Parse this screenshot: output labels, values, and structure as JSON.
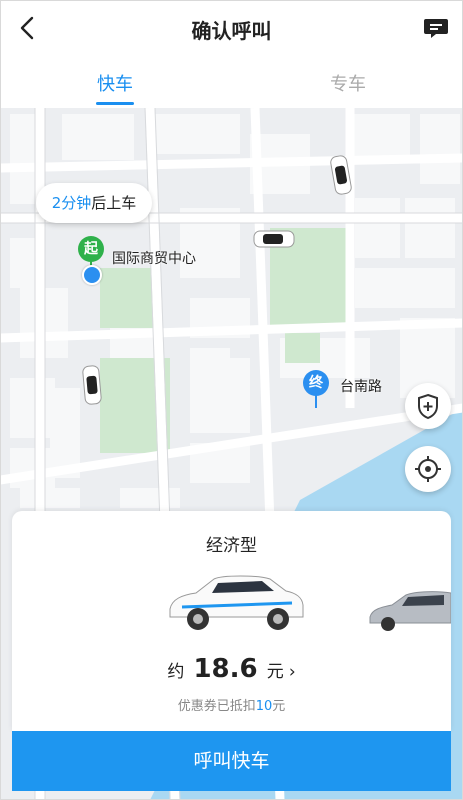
{
  "header": {
    "title": "确认呼叫",
    "back_icon": "chevron-left-icon",
    "message_icon": "message-icon"
  },
  "tabs": [
    {
      "label": "快车",
      "active": true
    },
    {
      "label": "专车",
      "active": false
    }
  ],
  "map": {
    "pickup_bubble": {
      "number": "2",
      "unit_text": "分钟",
      "suffix": "后上车"
    },
    "start_pin": {
      "label": "起",
      "place": "国际商贸中心"
    },
    "end_pin": {
      "label": "终",
      "place": "台南路"
    },
    "safety_icon": "shield-plus-icon",
    "locate_icon": "locate-target-icon"
  },
  "card": {
    "car_type": "经济型",
    "price_prefix": "约",
    "price_value": "18.6",
    "price_unit": "元",
    "price_chevron": "›",
    "discount_text": "优惠券已抵扣",
    "discount_amount": "10",
    "discount_unit": "元"
  },
  "call_button": {
    "label": "呼叫快车"
  },
  "colors": {
    "accent": "#1a8ff0",
    "start_green": "#2fb14b",
    "map_bg": "#eceef1",
    "water": "#a9d8f2"
  }
}
